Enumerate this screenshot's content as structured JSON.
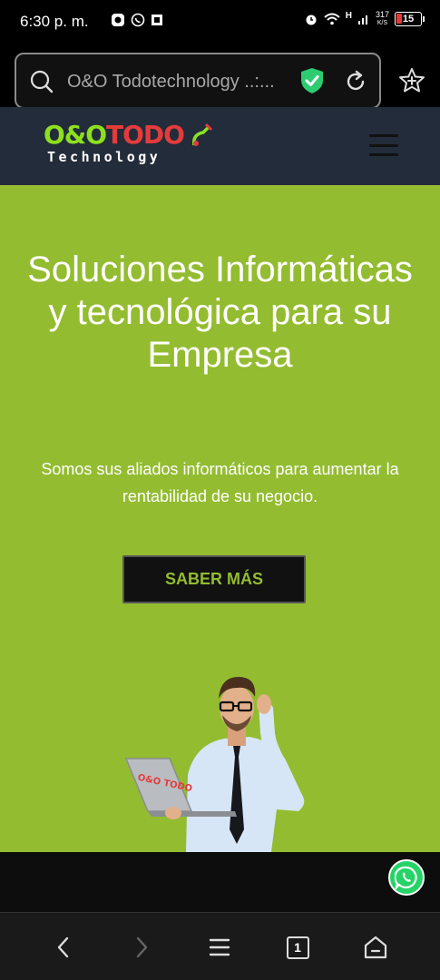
{
  "status_bar": {
    "time": "6:30 p. m.",
    "network_speed_value": "317",
    "network_speed_unit": "K/S",
    "network_type": "H",
    "battery_level": "15"
  },
  "browser": {
    "url": "O&O Todotechnology ..:...",
    "tab_count": "1"
  },
  "site": {
    "logo_top": [
      "O&O",
      "TODO"
    ],
    "logo_bottom": "Technology",
    "hero": {
      "title": "Soluciones Informáticas y tecnológica para su Empresa",
      "subtitle": "Somos sus aliados informáticos para aumentar la rentabilidad de su negocio.",
      "cta_label": "SABER MÁS"
    },
    "laptop_logo": "O&O TODO"
  },
  "colors": {
    "hero_bg": "#93bc30",
    "header_bg": "#232c3a",
    "logo_green": "#8ee01f",
    "logo_red": "#e43b3b",
    "whatsapp": "#25d366",
    "shield": "#2ecc71"
  }
}
